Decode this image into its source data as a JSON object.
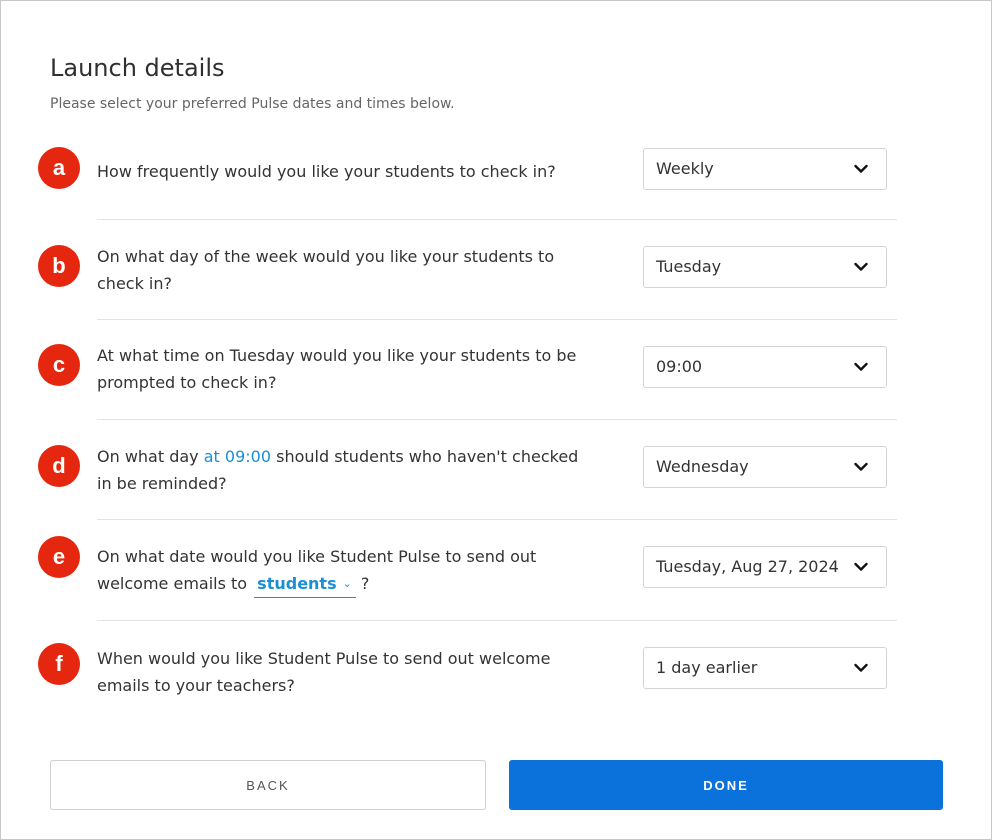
{
  "header": {
    "title": "Launch details",
    "subtitle": "Please select your preferred Pulse dates and times below."
  },
  "questions": [
    {
      "badge": "a",
      "text": "How frequently would you like your students to check in?",
      "value": "Weekly"
    },
    {
      "badge": "b",
      "text": "On what day of the week would you like your students to check in?",
      "value": "Tuesday"
    },
    {
      "badge": "c",
      "text": "At what time on Tuesday would you like your students to be prompted to check in?",
      "value": "09:00"
    },
    {
      "badge": "d",
      "text_before": "On what day ",
      "text_highlight": "at 09:00",
      "text_after": " should students who haven't checked in be reminded?",
      "value": "Wednesday"
    },
    {
      "badge": "e",
      "text_before": "On what date would you like Student Pulse to send out welcome emails to ",
      "recipient_option": "students",
      "text_after": " ?",
      "value": "Tuesday, Aug 27, 2024"
    },
    {
      "badge": "f",
      "text": "When would you like Student Pulse to send out welcome emails to your teachers?",
      "value": "1 day earlier"
    }
  ],
  "footer": {
    "back_label": "BACK",
    "done_label": "DONE"
  },
  "colors": {
    "badge": "#e6270f",
    "accent": "#1a8fd6",
    "primary_button": "#0b72dc"
  },
  "icons": {
    "select_chevron": "chevron-down-icon",
    "inline_chevron": "chevron-down-small-icon"
  }
}
